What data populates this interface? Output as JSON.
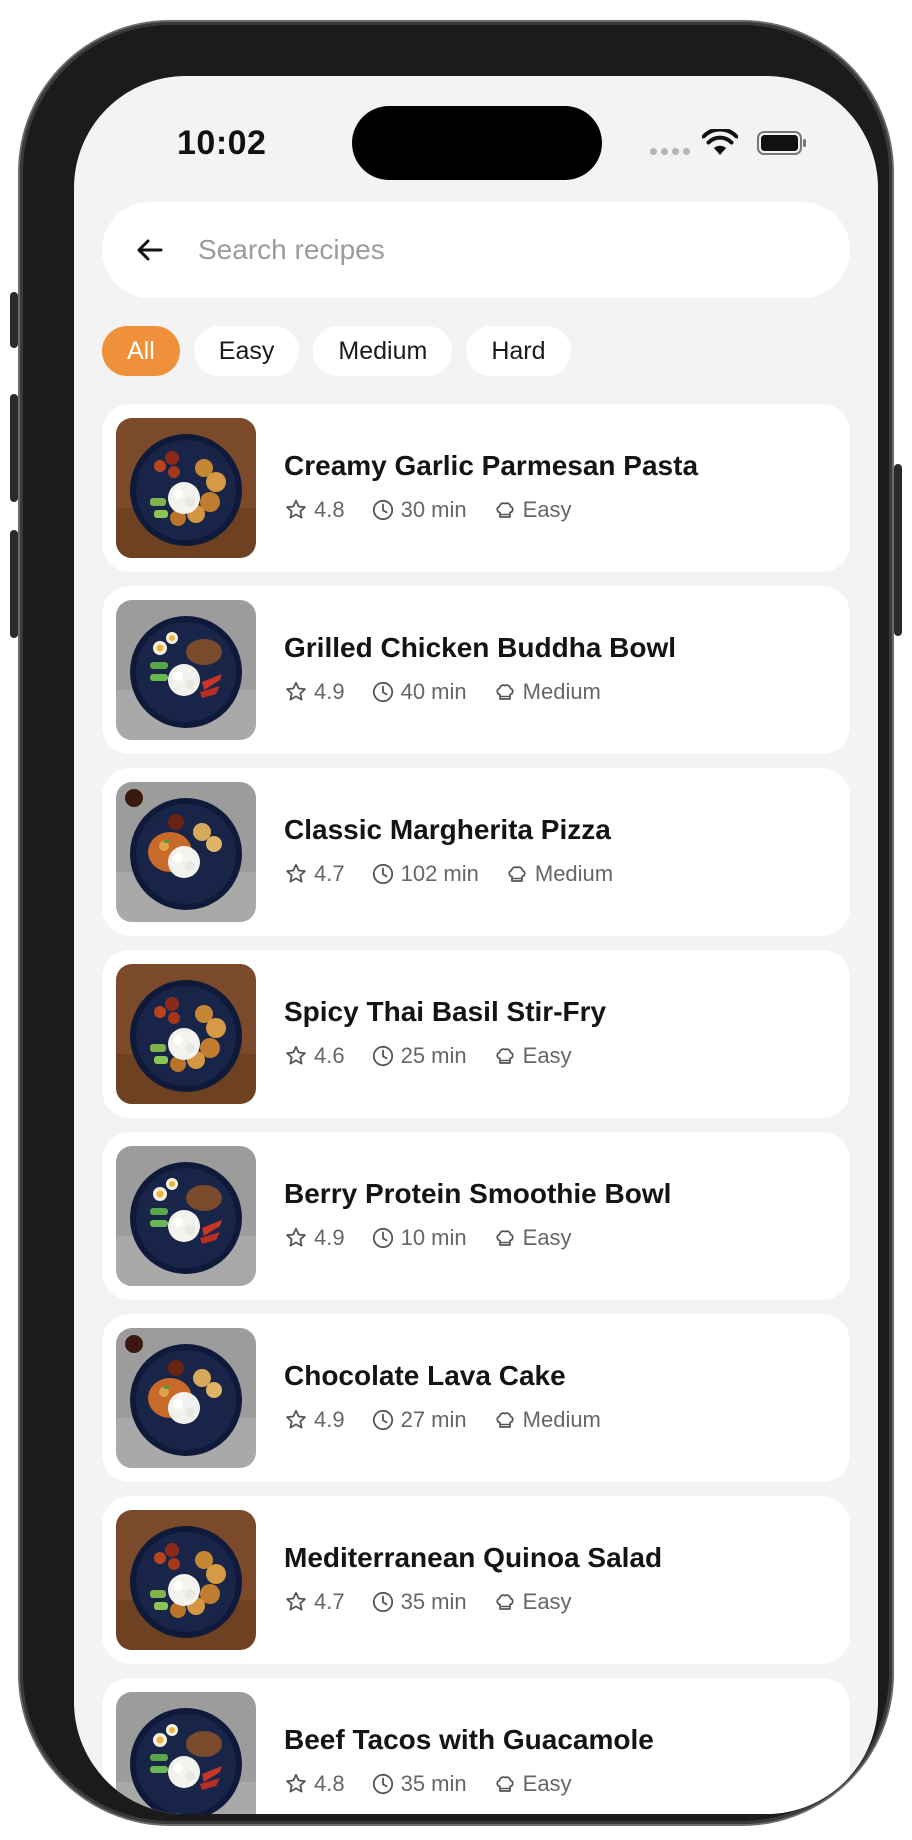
{
  "status_bar": {
    "time": "10:02"
  },
  "search": {
    "placeholder": "Search recipes"
  },
  "filters": [
    "All",
    "Easy",
    "Medium",
    "Hard"
  ],
  "colors": {
    "accent": "#ee913a",
    "background": "#f3f3f3",
    "card": "#ffffff"
  },
  "recipes": [
    {
      "title": "Creamy Garlic Parmesan Pasta",
      "rating": "4.8",
      "time": "30 min",
      "difficulty": "Easy",
      "image": "wood"
    },
    {
      "title": "Grilled Chicken Buddha Bowl",
      "rating": "4.9",
      "time": "40 min",
      "difficulty": "Medium",
      "image": "grey"
    },
    {
      "title": "Classic Margherita Pizza",
      "rating": "4.7",
      "time": "102 min",
      "difficulty": "Medium",
      "image": "curry"
    },
    {
      "title": "Spicy Thai Basil Stir-Fry",
      "rating": "4.6",
      "time": "25 min",
      "difficulty": "Easy",
      "image": "wood"
    },
    {
      "title": "Berry Protein Smoothie Bowl",
      "rating": "4.9",
      "time": "10 min",
      "difficulty": "Easy",
      "image": "grey"
    },
    {
      "title": "Chocolate Lava Cake",
      "rating": "4.9",
      "time": "27 min",
      "difficulty": "Medium",
      "image": "curry"
    },
    {
      "title": "Mediterranean Quinoa Salad",
      "rating": "4.7",
      "time": "35 min",
      "difficulty": "Easy",
      "image": "wood"
    },
    {
      "title": "Beef Tacos with Guacamole",
      "rating": "4.8",
      "time": "35 min",
      "difficulty": "Easy",
      "image": "grey"
    }
  ]
}
